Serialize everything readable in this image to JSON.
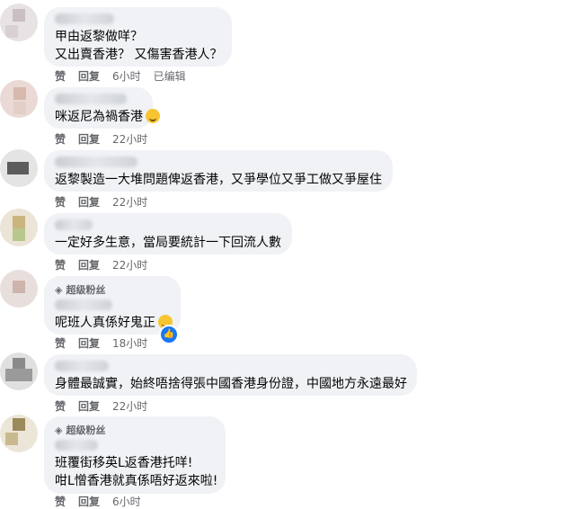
{
  "common": {
    "like_label": "赞",
    "reply_label": "回复"
  },
  "comments": [
    {
      "badge": "",
      "lines": [
        "甲由返黎做咩？",
        "又出賣香港？ 又傷害香港人？"
      ],
      "time": "6小时",
      "edited": "已编辑"
    },
    {
      "badge": "",
      "lines": [
        "咪返尼為禍香港"
      ],
      "time": "22小时"
    },
    {
      "badge": "",
      "lines": [
        "返黎製造一大堆問題俾返香港，又爭學位又爭工做又爭屋住"
      ],
      "time": "22小时"
    },
    {
      "badge": "",
      "lines": [
        "一定好多生意，當局要統計一下回流人數"
      ],
      "time": "22小时"
    },
    {
      "badge": "超级粉丝",
      "lines": [
        "呢班人真係好鬼正"
      ],
      "time": "18小时"
    },
    {
      "badge": "",
      "lines": [
        "身體最誠實，始終唔捨得張中國香港身份證，中國地方永遠最好"
      ],
      "time": "22小时"
    },
    {
      "badge": "超级粉丝",
      "lines": [
        "班覆街移英L返香港托咩!",
        "咁L憎香港就真係唔好返來啦!"
      ],
      "time": "6小时"
    }
  ],
  "icons": {
    "badge": "diamond-icon",
    "emoji": "laughing-emoji-icon",
    "reaction": "like-reaction-icon"
  },
  "colors": {
    "bubble": "#f0f2f5",
    "meta": "#65676b",
    "like_blue": "#1877f2"
  }
}
